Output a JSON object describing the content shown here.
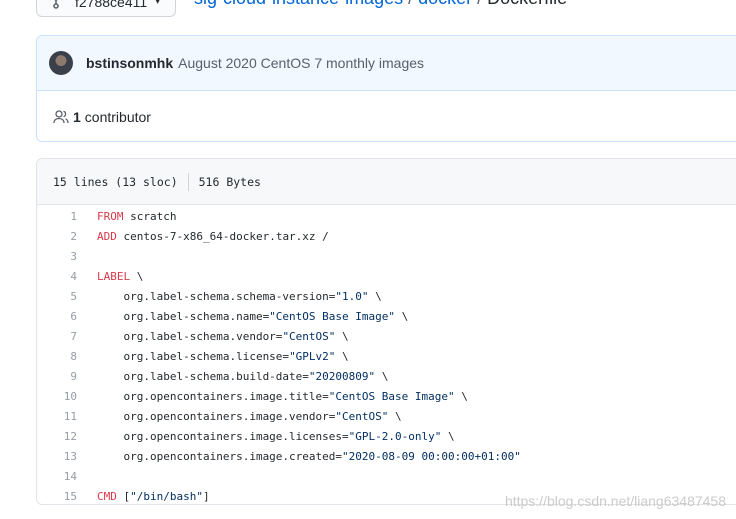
{
  "branch": {
    "label": "f2788ce411",
    "caret": "▾"
  },
  "breadcrumb": {
    "repo": "sig-cloud-instance-images",
    "sep1": "/",
    "folder": "docker",
    "sep2": "/",
    "file": "Dockerfile"
  },
  "commit": {
    "author": "bstinsonmhk",
    "message": "August 2020 CentOS 7 monthly images"
  },
  "contributors": {
    "count": "1",
    "label": "contributor"
  },
  "file_info": {
    "lines": "15 lines (13 sloc)",
    "size": "516 Bytes"
  },
  "code_lines": [
    {
      "n": "1",
      "kw": "FROM",
      "rest": " scratch",
      "str": "",
      "tail": ""
    },
    {
      "n": "2",
      "kw": "ADD",
      "rest": " centos-7-x86_64-docker.tar.xz /",
      "str": "",
      "tail": ""
    },
    {
      "n": "3",
      "kw": "",
      "rest": "",
      "str": "",
      "tail": ""
    },
    {
      "n": "4",
      "kw": "LABEL",
      "rest": " \\",
      "str": "",
      "tail": ""
    },
    {
      "n": "5",
      "kw": "",
      "rest": "    org.label-schema.schema-version=",
      "str": "\"1.0\"",
      "tail": " \\"
    },
    {
      "n": "6",
      "kw": "",
      "rest": "    org.label-schema.name=",
      "str": "\"CentOS Base Image\"",
      "tail": " \\"
    },
    {
      "n": "7",
      "kw": "",
      "rest": "    org.label-schema.vendor=",
      "str": "\"CentOS\"",
      "tail": " \\"
    },
    {
      "n": "8",
      "kw": "",
      "rest": "    org.label-schema.license=",
      "str": "\"GPLv2\"",
      "tail": " \\"
    },
    {
      "n": "9",
      "kw": "",
      "rest": "    org.label-schema.build-date=",
      "str": "\"20200809\"",
      "tail": " \\"
    },
    {
      "n": "10",
      "kw": "",
      "rest": "    org.opencontainers.image.title=",
      "str": "\"CentOS Base Image\"",
      "tail": " \\"
    },
    {
      "n": "11",
      "kw": "",
      "rest": "    org.opencontainers.image.vendor=",
      "str": "\"CentOS\"",
      "tail": " \\"
    },
    {
      "n": "12",
      "kw": "",
      "rest": "    org.opencontainers.image.licenses=",
      "str": "\"GPL-2.0-only\"",
      "tail": " \\"
    },
    {
      "n": "13",
      "kw": "",
      "rest": "    org.opencontainers.image.created=",
      "str": "\"2020-08-09 00:00:00+01:00\"",
      "tail": ""
    },
    {
      "n": "14",
      "kw": "",
      "rest": "",
      "str": "",
      "tail": ""
    },
    {
      "n": "15",
      "kw": "CMD",
      "rest": " [",
      "str": "\"/bin/bash\"",
      "tail": "]"
    }
  ],
  "watermark": "https://blog.csdn.net/liang63487458",
  "colors": {
    "link": "#0366d6",
    "keyword": "#d73a49",
    "string": "#032f62",
    "commit_bg": "#f1f8ff"
  }
}
